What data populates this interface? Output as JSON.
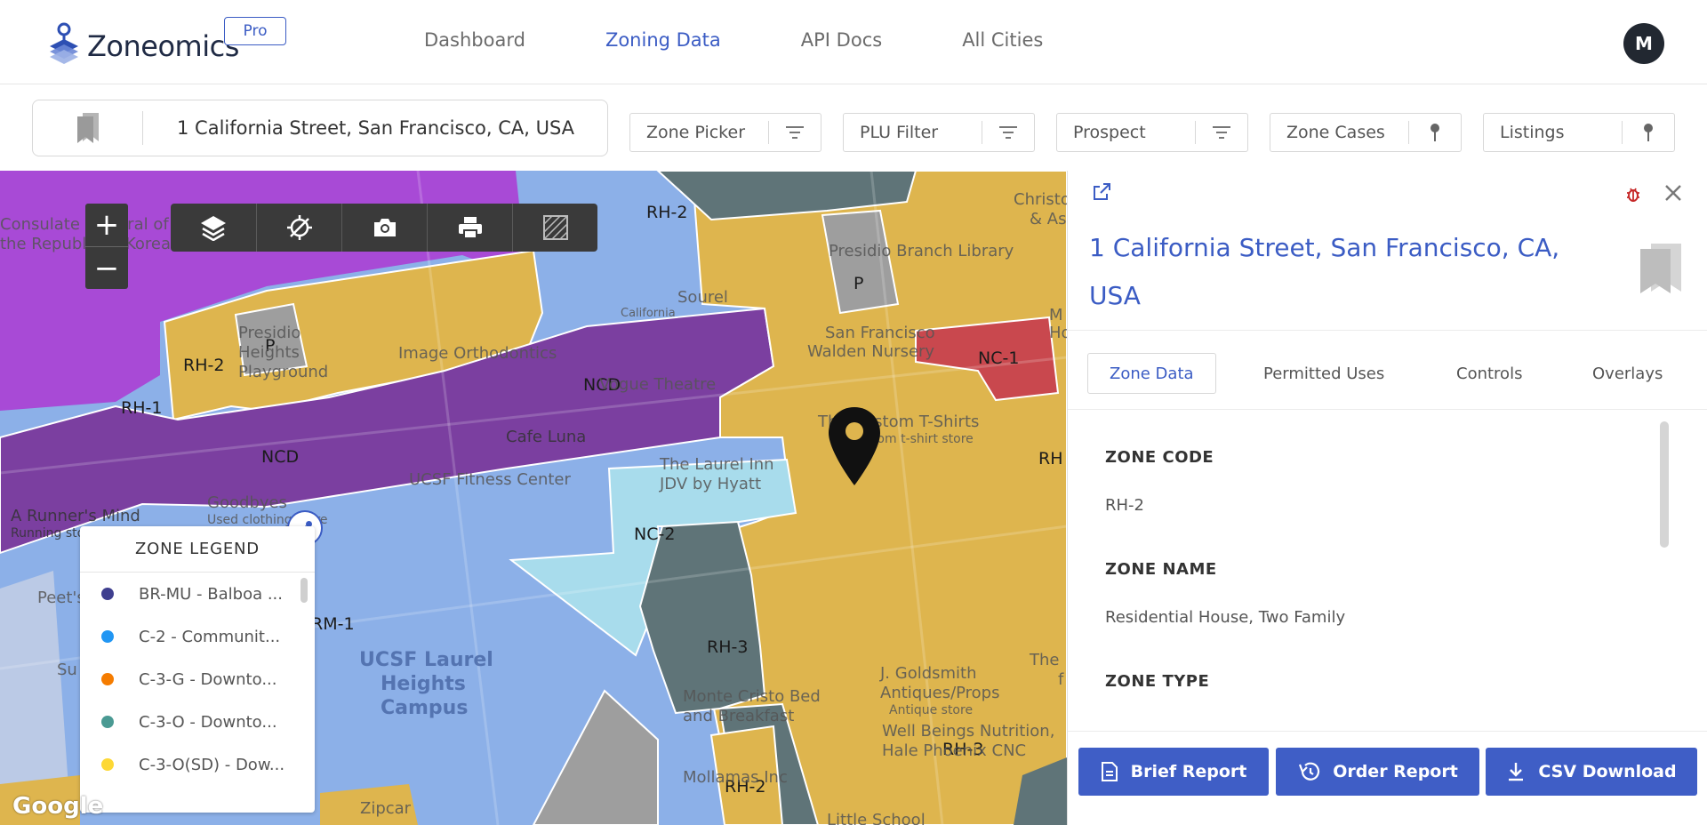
{
  "header": {
    "logo_text": "Zoneomics",
    "badge": "Pro",
    "nav": [
      {
        "label": "Dashboard",
        "active": false
      },
      {
        "label": "Zoning Data",
        "active": true
      },
      {
        "label": "API Docs",
        "active": false
      },
      {
        "label": "All Cities",
        "active": false
      }
    ],
    "avatar_initial": "M"
  },
  "filters": {
    "address": "1 California Street, San Francisco, CA, USA",
    "items": [
      {
        "label": "Zone Picker",
        "icon": "filter-icon"
      },
      {
        "label": "PLU Filter",
        "icon": "filter-icon"
      },
      {
        "label": "Prospect",
        "icon": "filter-icon"
      },
      {
        "label": "Zone Cases",
        "icon": "pin-icon"
      },
      {
        "label": "Listings",
        "icon": "pin-icon"
      }
    ]
  },
  "map": {
    "zoom_in": "+",
    "zoom_out": "−",
    "tools": [
      "layers-icon",
      "satellite-off-icon",
      "camera-icon",
      "print-icon",
      "grid-off-icon"
    ],
    "zone_labels": [
      "RH-2",
      "RH-2",
      "P",
      "RH-1",
      "NCD",
      "NCD",
      "P",
      "NC-1",
      "NC-2",
      "RH-3",
      "RH-3",
      "RM-1",
      "RH-2",
      "RH"
    ],
    "poi_labels": [
      "Consulate General of",
      "the Republic of Korea",
      "Presidio",
      "Heights",
      "Playground",
      "Image Orthodontics",
      "Sourel",
      "California",
      "Vogue Theatre",
      "Cafe Luna",
      "UCSF Fitness Center",
      "The Laurel Inn",
      "JDV by Hyatt",
      "A Runner's Mind",
      "Running store",
      "Goodbyes",
      "Used clothing store",
      "Presidio Branch Library",
      "San Francisco",
      "Walden Nursery",
      "The Custom T-Shirts",
      "Custom t-shirt store",
      "UCSF Laurel",
      "Heights",
      "Campus",
      "J. Goldsmith",
      "Antiques/Props",
      "Antique store",
      "Monte Cristo Bed",
      "and Breakfast",
      "Well Beings Nutrition,",
      "Hale Phoenix CNC",
      "Mollamas Inc",
      "Zipcar",
      "Little School",
      "Peet's",
      "Su",
      "Christoph",
      "& Asso",
      "M",
      "Ho",
      "The",
      "f"
    ],
    "google": "Google",
    "legend": {
      "title": "ZONE LEGEND",
      "items": [
        {
          "label": "BR-MU - Balboa ...",
          "color": "#3f3f8f"
        },
        {
          "label": "C-2 - Communit...",
          "color": "#2196f3"
        },
        {
          "label": "C-3-G - Downto...",
          "color": "#f57c00"
        },
        {
          "label": "C-3-O - Downto...",
          "color": "#4a9a93"
        },
        {
          "label": "C-3-O(SD) - Dow...",
          "color": "#fdd835"
        }
      ]
    }
  },
  "panel": {
    "title": "1 California Street, San Francisco, CA, USA",
    "tabs": [
      {
        "label": "Zone Data",
        "active": true
      },
      {
        "label": "Permitted Uses",
        "active": false
      },
      {
        "label": "Controls",
        "active": false
      },
      {
        "label": "Overlays",
        "active": false
      }
    ],
    "fields": [
      {
        "label": "ZONE CODE",
        "value": "RH-2"
      },
      {
        "label": "ZONE NAME",
        "value": "Residential House, Two Family"
      },
      {
        "label": "ZONE TYPE",
        "value": ""
      }
    ],
    "actions": [
      {
        "label": "Brief Report",
        "icon": "document-icon"
      },
      {
        "label": "Order Report",
        "icon": "history-icon"
      },
      {
        "label": "CSV Download",
        "icon": "download-icon"
      }
    ]
  },
  "colors": {
    "brand_blue": "#3b5cc4",
    "button_blue": "#3f5ec6",
    "zone_purple": "#a84ad6",
    "zone_dark_purple": "#7b3fa0",
    "zone_yellow": "#deb54e",
    "zone_blue": "#8cb0e8",
    "zone_light_blue": "#a8dcec",
    "zone_slate": "#5f7478",
    "zone_gray": "#9e9e9e",
    "zone_red": "#c9484e"
  }
}
